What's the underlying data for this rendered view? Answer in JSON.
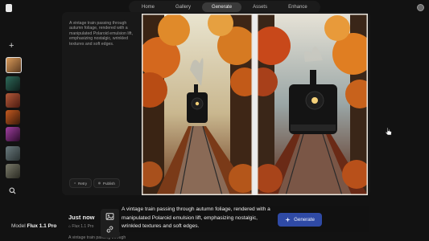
{
  "nav": {
    "tabs": [
      {
        "label": "Home"
      },
      {
        "label": "Gallery"
      },
      {
        "label": "Generate",
        "active": true
      },
      {
        "label": "Assets"
      },
      {
        "label": "Enhance"
      }
    ]
  },
  "sidebar": {
    "new_icon": "plus-icon",
    "search_icon": "search-icon",
    "thumbnails": [
      {
        "color": "#a26a3a",
        "selected": true
      },
      {
        "color": "#20463e"
      },
      {
        "color": "#8a3c28"
      },
      {
        "color": "#7a3a1a"
      },
      {
        "color": "#6a2a6a"
      },
      {
        "color": "#3a4a4e"
      },
      {
        "color": "#4a4a42"
      }
    ]
  },
  "card": {
    "prompt_preview": "A vintage train passing through autumn foliage, rendered with a manipulated Polaroid emulsion lift, emphasizing nostalgic, wrinkled textures and soft edges.",
    "retry_label": "Retry",
    "publish_label": "Publish"
  },
  "bottom": {
    "model_prefix": "Model",
    "model_name": "Flux 1.1 Pro",
    "history_title": "Just now",
    "history_model": "Flux 1.1 Pro",
    "history_prompt": "A vintage train passing through",
    "prompt_text": "A vintage train passing through autumn foliage, rendered with a manipulated Polaroid emulsion lift, emphasizing nostalgic, wrinkled textures and soft edges.",
    "generate_label": "Generate"
  },
  "colors": {
    "background": "#121212",
    "accent": "#2f4aa5"
  }
}
